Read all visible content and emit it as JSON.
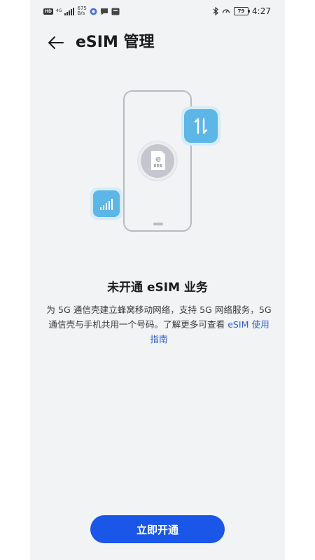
{
  "statusbar": {
    "hd": "HD",
    "network": "4G",
    "speed_value": "675",
    "speed_unit": "B/s",
    "battery": "79",
    "time": "4:27"
  },
  "header": {
    "title": "eSIM 管理"
  },
  "illustration": {
    "chip_label": "e",
    "accent": "#5cb6e6"
  },
  "main": {
    "headline": "未开通 eSIM 业务",
    "description_lead": "为 5G 通信壳建立蜂窝移动网络，支持 5G 网络服务，5G 通信壳与手机共用一个号码。了解更多可查看 ",
    "description_link": "eSIM 使用指南"
  },
  "footer": {
    "action_label": "立即开通"
  },
  "colors": {
    "background": "#f1f3f5",
    "primary": "#1a56e8",
    "link": "#2f5fcf"
  }
}
